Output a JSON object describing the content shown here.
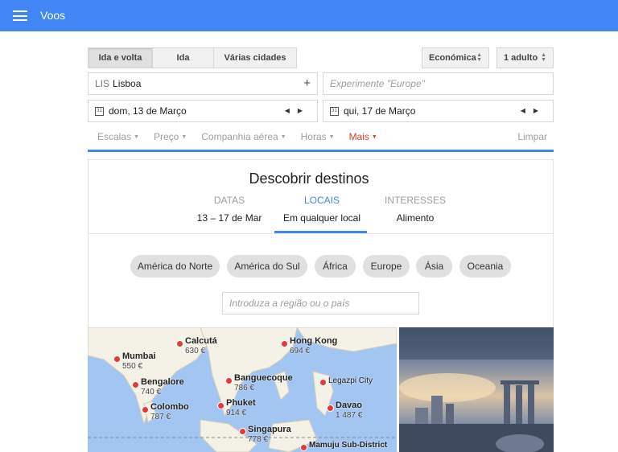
{
  "app": {
    "title": "Voos"
  },
  "trip_type": {
    "options": [
      "Ida e volta",
      "Ida",
      "Várias cidades"
    ],
    "selected": "Ida e volta"
  },
  "cabin_class": {
    "value": "Económica"
  },
  "passengers": {
    "value": "1 adulto"
  },
  "origin": {
    "code": "LIS",
    "city": "Lisboa"
  },
  "destination": {
    "placeholder": "Experimente \"Europe\""
  },
  "departure": {
    "date": "dom, 13 de Março"
  },
  "return": {
    "date": "qui, 17 de Março"
  },
  "filters": {
    "items": [
      "Escalas",
      "Preço",
      "Companhia aérea",
      "Horas",
      "Mais"
    ],
    "clear_label": "Limpar"
  },
  "discover": {
    "title": "Descobrir destinos",
    "tabs": [
      {
        "label": "DATAS",
        "value": "13 – 17 de Mar"
      },
      {
        "label": "LOCAIS",
        "value": "Em qualquer local"
      },
      {
        "label": "INTERESSES",
        "value": "Alimento"
      }
    ],
    "active_tab": "LOCAIS",
    "regions": [
      "América do Norte",
      "América do Sul",
      "África",
      "Europe",
      "Ásia",
      "Oceania"
    ],
    "region_search_placeholder": "Introduza a região ou o país"
  },
  "map": {
    "destinations": [
      {
        "city": "Calcutá",
        "price": "630 €"
      },
      {
        "city": "Hong Kong",
        "price": "694 €"
      },
      {
        "city": "Mumbai",
        "price": "550 €"
      },
      {
        "city": "Bengalore",
        "price": "740 €"
      },
      {
        "city": "Banguecoque",
        "price": "786 €"
      },
      {
        "city": "Legazpi City",
        "price": ""
      },
      {
        "city": "Colombo",
        "price": "787 €"
      },
      {
        "city": "Phuket",
        "price": "914 €"
      },
      {
        "city": "Davao",
        "price": "1 487 €"
      },
      {
        "city": "Singapura",
        "price": "778 €"
      },
      {
        "city": "Mamuju Sub-District",
        "price": ""
      }
    ]
  },
  "colors": {
    "accent": "#4285f4",
    "active_filter": "#d23f31"
  }
}
